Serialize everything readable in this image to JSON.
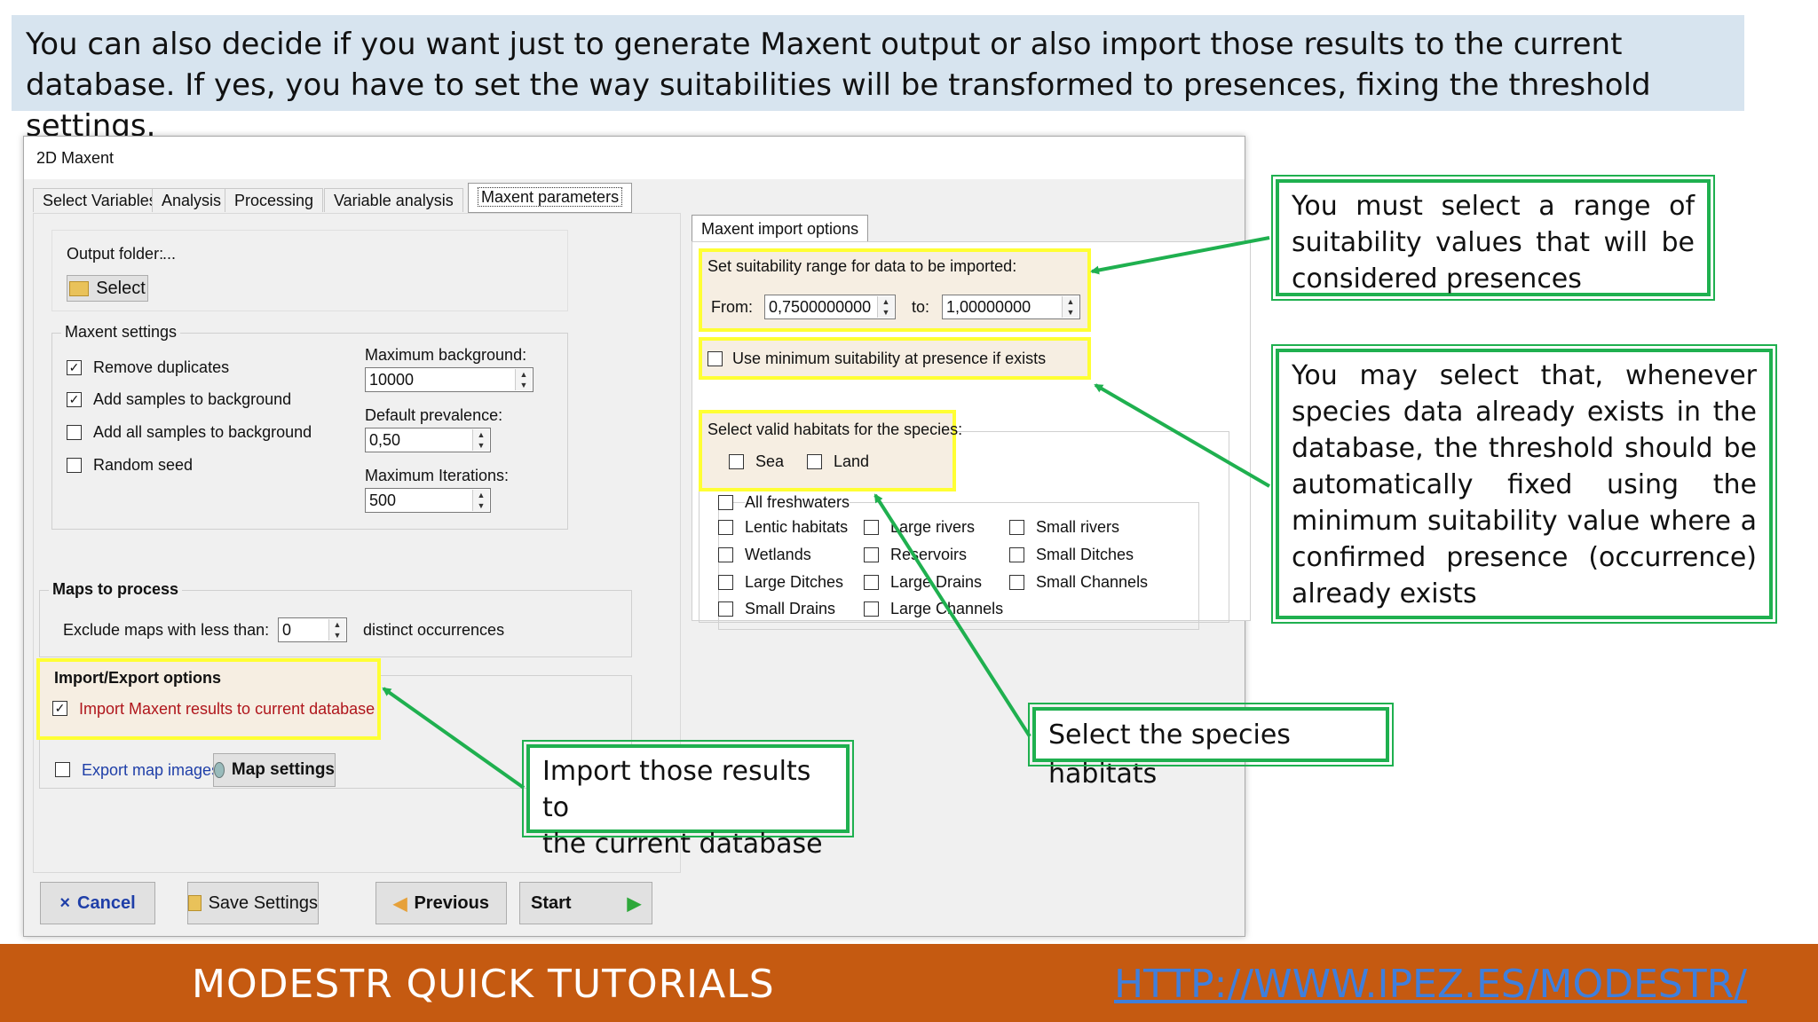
{
  "banner": {
    "text": "You can also decide if you want just to generate Maxent output or also import those results to the current database. If yes, you have to set the way suitabilities will be transformed to presences, fixing  the threshold settings."
  },
  "window": {
    "title": "2D Maxent",
    "tabs": [
      {
        "label": "Select Variables"
      },
      {
        "label": "Analysis"
      },
      {
        "label": "Processing"
      },
      {
        "label": "Variable analysis"
      },
      {
        "label": "Maxent parameters"
      }
    ],
    "output_folder": {
      "label": "Output folder:",
      "value": "...",
      "select_label": "Select"
    },
    "maxent_settings": {
      "legend": "Maxent settings",
      "remove_duplicates": {
        "label": "Remove duplicates",
        "checked": true
      },
      "add_samples": {
        "label": "Add samples to background",
        "checked": true
      },
      "add_all_samples": {
        "label": "Add all samples to background",
        "checked": false
      },
      "random_seed": {
        "label": "Random seed",
        "checked": false
      },
      "max_background": {
        "label": "Maximum background:",
        "value": "10000"
      },
      "default_prevalence": {
        "label": "Default prevalence:",
        "value": "0,50"
      },
      "max_iterations": {
        "label": "Maximum Iterations:",
        "value": "500"
      }
    },
    "maps": {
      "legend": "Maps to process",
      "exclude_label": "Exclude maps with less than:",
      "exclude_value": "0",
      "suffix": "distinct occurrences"
    },
    "import_export": {
      "legend": "Import/Export options",
      "import_label": "Import Maxent results to current database",
      "import_checked": true,
      "export_label": "Export map images",
      "export_checked": false,
      "map_settings_label": "Map settings"
    },
    "import_options": {
      "tab_label": "Maxent import options",
      "range_legend": "Set suitability range for data to be imported:",
      "from_label": "From:",
      "from_value": "0,7500000000",
      "to_label": "to:",
      "to_value": "1,00000000",
      "min_suit_label": "Use minimum suitability at presence if exists",
      "habitats_legend": "Select valid habitats for the species:",
      "sea": "Sea",
      "land": "Land",
      "all_freshwaters": "All freshwaters",
      "habitats_col1": [
        "Lentic habitats",
        "Wetlands",
        "Large Ditches",
        "Small Drains"
      ],
      "habitats_col2": [
        "Large rivers",
        "Reservoirs",
        "Large Drains",
        "Large Channels"
      ],
      "habitats_col3": [
        "Small rivers",
        "Small Ditches",
        "Small Channels"
      ]
    },
    "buttons": {
      "cancel": "Cancel",
      "save": "Save Settings",
      "previous": "Previous",
      "start": "Start"
    }
  },
  "callouts": {
    "range": "You must select a range of suitability values that will be considered presences",
    "min_suit_main": "You may select that, whenever species data already exists in the database, the threshold should be automatically fixed using the minimum suitability value where a confirmed presence (occurrence)",
    "min_suit_last": "already exists",
    "habitats": "Select the species habitats",
    "import_main": "Import those results to",
    "import_last": "the current database"
  },
  "footer": {
    "title": "MODESTR QUICK TUTORIALS",
    "url": "HTTP://WWW.IPEZ.ES/MODESTR/"
  },
  "colors": {
    "callout_border": "#1fb04f",
    "highlight_border": "#ffff33",
    "footer_bg": "#c55a11",
    "banner_bg": "#d7e4ef"
  }
}
